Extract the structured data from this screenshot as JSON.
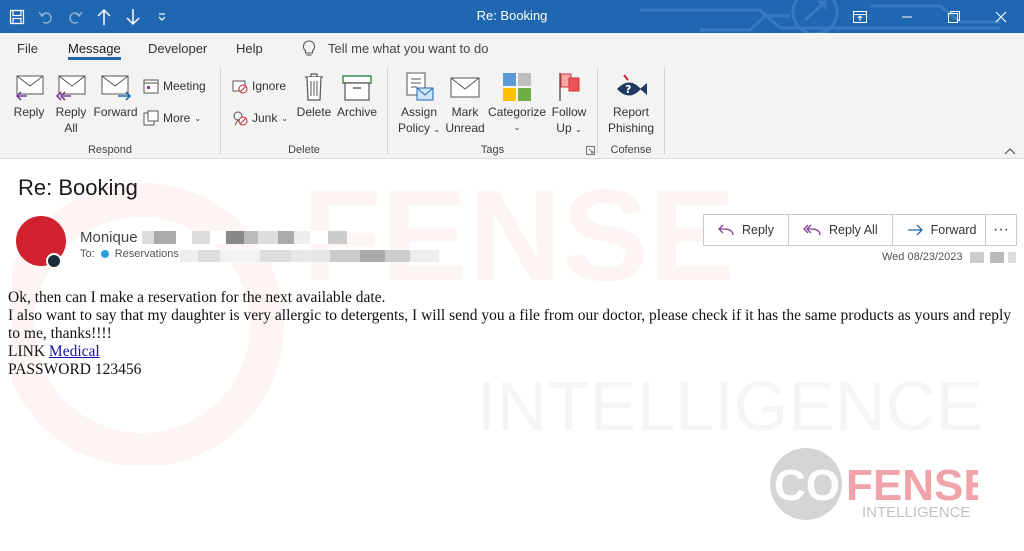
{
  "window": {
    "title": "Re: Booking",
    "colors": {
      "titlebar": "#1f67b1",
      "accent": "#1f67b1"
    },
    "quick_access": [
      "save-icon",
      "undo-icon",
      "redo-icon",
      "up-arrow-icon",
      "down-arrow-icon",
      "customize-icon"
    ],
    "controls": [
      "ribbon-display-icon",
      "minimize-icon",
      "restore-icon",
      "close-icon"
    ]
  },
  "menu": {
    "tabs": [
      {
        "label": "File"
      },
      {
        "label": "Message"
      },
      {
        "label": "Developer"
      },
      {
        "label": "Help"
      }
    ],
    "tell_me": "Tell me what you want to do"
  },
  "ribbon": {
    "respond": {
      "label": "Respond",
      "reply": "Reply",
      "reply_all_1": "Reply",
      "reply_all_2": "All",
      "forward": "Forward",
      "meeting": "Meeting",
      "more": "More"
    },
    "delete": {
      "label": "Delete",
      "ignore": "Ignore",
      "junk": "Junk",
      "delete": "Delete",
      "archive": "Archive"
    },
    "tags": {
      "label": "Tags",
      "assign_1": "Assign",
      "assign_2": "Policy",
      "mark_1": "Mark",
      "mark_2": "Unread",
      "categorize": "Categorize",
      "follow_1": "Follow",
      "follow_2": "Up"
    },
    "cofense": {
      "label": "Cofense",
      "report_1": "Report",
      "report_2": "Phishing"
    }
  },
  "message": {
    "subject": "Re: Booking",
    "sender_name": "Monique",
    "to_label": "To:",
    "recipient": "Reservations",
    "date": "Wed 08/23/2023",
    "actions": {
      "reply": "Reply",
      "reply_all": "Reply All",
      "forward": "Forward"
    },
    "more": "···",
    "body": {
      "line1": "Ok, then can I make a reservation for the next available date.",
      "line2": "I also want to say that my daughter is very allergic to detergents, I will send you a file from our doctor, please check if it has the same products as yours and reply to me, thanks!!!!",
      "link_prefix": "LINK ",
      "link_text": "Medical",
      "password": "PASSWORD 123456"
    },
    "avatar_color": "#d1202e"
  },
  "watermark": {
    "brand": "COFENSE",
    "sub": "INTELLIGENCE"
  }
}
